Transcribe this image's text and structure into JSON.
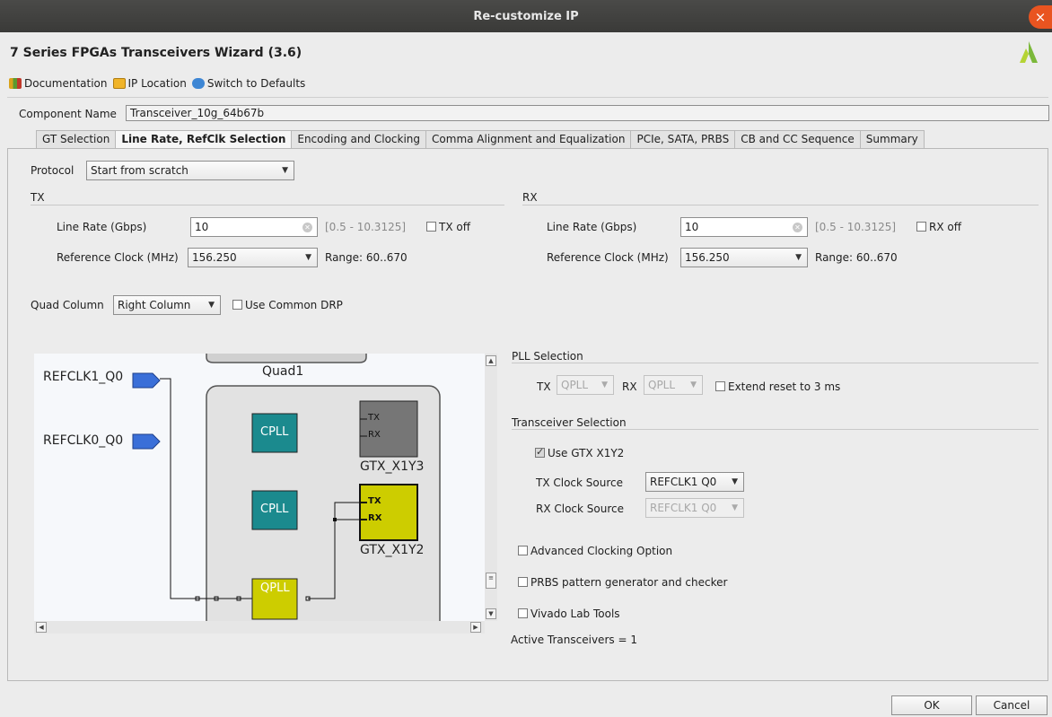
{
  "window": {
    "title": "Re-customize IP",
    "close_glyph": "×"
  },
  "wizard_title": "7 Series FPGAs Transceivers Wizard (3.6)",
  "toolbar": {
    "documentation": "Documentation",
    "ip_location": "IP Location",
    "switch_defaults": "Switch to Defaults"
  },
  "component": {
    "label": "Component Name",
    "value": "Transceiver_10g_64b67b"
  },
  "tabs": [
    {
      "label": "GT Selection",
      "active": false
    },
    {
      "label": "Line Rate, RefClk Selection",
      "active": true
    },
    {
      "label": "Encoding and Clocking",
      "active": false
    },
    {
      "label": "Comma Alignment and Equalization",
      "active": false
    },
    {
      "label": "PCIe, SATA, PRBS",
      "active": false
    },
    {
      "label": "CB and CC Sequence",
      "active": false
    },
    {
      "label": "Summary",
      "active": false
    }
  ],
  "protocol": {
    "label": "Protocol",
    "value": "Start from scratch"
  },
  "tx": {
    "heading": "TX",
    "line_rate_label": "Line Rate (Gbps)",
    "line_rate_value": "10",
    "line_rate_range": "[0.5 - 10.3125]",
    "off_label": "TX off",
    "refclk_label": "Reference Clock (MHz)",
    "refclk_value": "156.250",
    "refclk_range": "Range: 60..670"
  },
  "rx": {
    "heading": "RX",
    "line_rate_label": "Line Rate (Gbps)",
    "line_rate_value": "10",
    "line_rate_range": "[0.5 - 10.3125]",
    "off_label": "RX off",
    "refclk_label": "Reference Clock (MHz)",
    "refclk_value": "156.250",
    "refclk_range": "Range: 60..670"
  },
  "quad_column": {
    "label": "Quad Column",
    "value": "Right Column",
    "common_drp_label": "Use Common DRP"
  },
  "diagram": {
    "quad_label": "Quad1",
    "refclk1": "REFCLK1_Q0",
    "refclk0": "REFCLK0_Q0",
    "cpll_label": "CPLL",
    "qpll_label": "QPLL",
    "tx_port": "TX",
    "rx_port": "RX",
    "gtx_x1y3": "GTX_X1Y3",
    "gtx_x1y2": "GTX_X1Y2",
    "colors": {
      "cpll": "#1b8a8e",
      "qpll": "#cdcd00",
      "gtx_unused": "#767676",
      "gtx_used": "#cdcd00",
      "quad_bg": "#e2e2e2",
      "refclk": "#3a6fd8"
    }
  },
  "pll_selection": {
    "heading": "PLL Selection",
    "tx_label": "TX",
    "tx_value": "QPLL",
    "rx_label": "RX",
    "rx_value": "QPLL",
    "extend_reset_label": "Extend reset to 3 ms"
  },
  "transceiver_selection": {
    "heading": "Transceiver Selection",
    "use_gtx_label": "Use GTX X1Y2",
    "tx_clock_label": "TX Clock Source",
    "tx_clock_value": "REFCLK1 Q0",
    "rx_clock_label": "RX Clock Source",
    "rx_clock_value": "REFCLK1 Q0"
  },
  "options": {
    "advanced_clocking": "Advanced Clocking Option",
    "prbs": "PRBS pattern generator and checker",
    "vivado_lab": "Vivado Lab Tools"
  },
  "active_transceivers": "Active Transceivers = 1",
  "buttons": {
    "ok": "OK",
    "cancel": "Cancel"
  }
}
